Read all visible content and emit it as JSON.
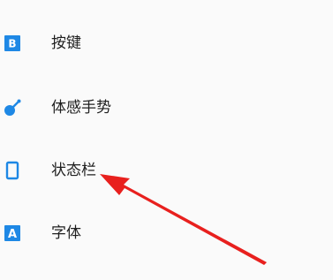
{
  "settings": {
    "items": [
      {
        "label": "按键",
        "icon": "letter-b-icon"
      },
      {
        "label": "体感手势",
        "icon": "gesture-icon"
      },
      {
        "label": "状态栏",
        "icon": "phone-outline-icon"
      },
      {
        "label": "字体",
        "icon": "letter-a-icon"
      }
    ]
  },
  "colors": {
    "accent": "#1e88e5",
    "arrow": "#e8201e",
    "text": "#202020",
    "background": "#fafafa"
  }
}
